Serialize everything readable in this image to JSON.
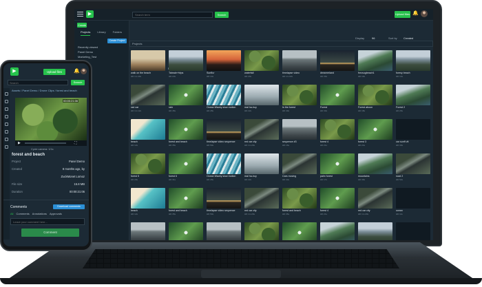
{
  "laptop": {
    "search": {
      "placeholder": "Search term",
      "button": "Search"
    },
    "top": {
      "upload": "Upload files",
      "new_label": "Create"
    },
    "sidebar": {
      "tabs": [
        {
          "label": "Projects"
        },
        {
          "label": "Library"
        },
        {
          "label": "Folders"
        }
      ],
      "create_btn": "Create Project",
      "items": [
        {
          "label": "Recently viewed"
        },
        {
          "label": "Panel Demo"
        },
        {
          "label": "Marketing_Test"
        }
      ]
    },
    "toolbar": {
      "display": "Display",
      "count": "96",
      "sort_label": "Sort by",
      "sort_value": "Created"
    },
    "filter": "Projects",
    "list_header": "Name",
    "tiles": [
      {
        "name": "walk on the beach",
        "meta": "HD 1m 40s",
        "thumb": "t-walk"
      },
      {
        "name": "Tatxsdn+trips",
        "meta": "HD 23s",
        "thumb": "t-mtn"
      },
      {
        "name": "Sunflur",
        "meta": "HD 14s",
        "thumb": "t-sunset"
      },
      {
        "name": "waterfall",
        "meta": "HD 20s",
        "thumb": "t-forest"
      },
      {
        "name": "timelapse video",
        "meta": "HD 1m 02s",
        "thumb": "t-city"
      },
      {
        "name": "dreamerland",
        "meta": "HD 30s",
        "thumb": "t-night"
      },
      {
        "name": "fnrcsugbeach1",
        "meta": "HD 19s",
        "thumb": "t-cliff"
      },
      {
        "name": "foresy beach",
        "meta": "HD 14s",
        "thumb": "t-mtn"
      },
      {
        "name": "rad car",
        "meta": "HD 1m 12s",
        "thumb": "t-road"
      },
      {
        "name": "rain",
        "meta": "HD 45s",
        "thumb": "t-palm"
      },
      {
        "name": "Ocean Wavey slow motion",
        "meta": "HD 28s",
        "thumb": "t-wave"
      },
      {
        "name": "mal ha-hoy",
        "meta": "HD 22s",
        "thumb": "t-fog"
      },
      {
        "name": "In the forest",
        "meta": "HD 40s",
        "thumb": "t-forest"
      },
      {
        "name": "Forest",
        "meta": "HD 33s",
        "thumb": "t-palm"
      },
      {
        "name": "Forest aboon",
        "meta": "HD 18s",
        "thumb": "t-forest"
      },
      {
        "name": "Forest 2",
        "meta": "HD 26s",
        "thumb": "t-cliff"
      },
      {
        "name": "beach",
        "meta": "HD 12s",
        "thumb": "t-beach"
      },
      {
        "name": "forest and beach",
        "meta": "HD 35s",
        "thumb": "t-palm"
      },
      {
        "name": "timelapse video sequence",
        "meta": "HD 50s",
        "thumb": "t-night"
      },
      {
        "name": "red car city",
        "meta": "HD 1m 20s",
        "thumb": "t-road"
      },
      {
        "name": "sequence #3",
        "meta": "HD 16s",
        "thumb": "t-city"
      },
      {
        "name": "forest 4",
        "meta": "HD 21s",
        "thumb": "t-forest"
      },
      {
        "name": "forest 3",
        "meta": "HD 24s",
        "thumb": "t-palm"
      },
      {
        "name": "car sunft vlt",
        "meta": "HD 30s",
        "thumb": "t-dark"
      },
      {
        "name": "forest 5",
        "meta": "HD 29s",
        "thumb": "t-forest"
      },
      {
        "name": "forest 6",
        "meta": "HD 31s",
        "thumb": "t-palm"
      },
      {
        "name": "Ocean Wavey slow motion",
        "meta": "HD 28s",
        "thumb": "t-wave"
      },
      {
        "name": "mal ha-hoy",
        "meta": "HD 22s",
        "thumb": "t-fog"
      },
      {
        "name": "Cars moving",
        "meta": "HD 44s",
        "thumb": "t-road"
      },
      {
        "name": "palm forest",
        "meta": "HD 17s",
        "thumb": "t-palm"
      },
      {
        "name": "mountains",
        "meta": "HD 39s",
        "thumb": "t-cliff"
      },
      {
        "name": "road 2",
        "meta": "HD 52s",
        "thumb": "t-road"
      },
      {
        "name": "beach",
        "meta": "HD 12s",
        "thumb": "t-beach"
      },
      {
        "name": "forest and beach",
        "meta": "HD 35s",
        "thumb": "t-palm"
      },
      {
        "name": "timelapse video sequence",
        "meta": "HD 50s",
        "thumb": "t-night"
      },
      {
        "name": "red car city",
        "meta": "HD 1m 20s",
        "thumb": "t-road"
      },
      {
        "name": "forest and beach",
        "meta": "HD 36s",
        "thumb": "t-forest"
      },
      {
        "name": "forest 4",
        "meta": "HD 21s",
        "thumb": "t-palm"
      },
      {
        "name": "red car city",
        "meta": "HD 1m 20s",
        "thumb": "t-road"
      },
      {
        "name": "ocean",
        "meta": "HD 11s",
        "thumb": "t-dark"
      },
      {
        "name": "city",
        "meta": "HD 18s",
        "thumb": "t-city"
      },
      {
        "name": "palms",
        "meta": "HD 20s",
        "thumb": "t-palm"
      },
      {
        "name": "city 2",
        "meta": "HD 25s",
        "thumb": "t-city"
      },
      {
        "name": "forest",
        "meta": "HD 27s",
        "thumb": "t-forest"
      },
      {
        "name": "forest",
        "meta": "HD 27s",
        "thumb": "t-palm"
      },
      {
        "name": "coast",
        "meta": "HD 33s",
        "thumb": "t-cliff"
      },
      {
        "name": "cliff",
        "meta": "HD 41s",
        "thumb": "t-mtn"
      },
      {
        "name": "night",
        "meta": "HD 15s",
        "thumb": "t-dark"
      }
    ]
  },
  "phone": {
    "upload": "Upload files",
    "search_placeholder": "Search",
    "search_btn": "Search",
    "breadcrumb": "Assets / Panel Demo / Drone Clips / forest and beach",
    "timecode": "00:00:21:06",
    "cycle_label": "Cycle camera: 1/1s",
    "title": "forest and beach",
    "props": [
      {
        "label": "Project",
        "value": "Panel Demo"
      },
      {
        "label": "Created",
        "value": "8 months ago, by"
      },
      {
        "label": "",
        "value": "ZuckMonet Lomoz"
      },
      {
        "label": "File size",
        "value": "15.8 MB"
      },
      {
        "label": "Duration",
        "value": "00:00:21:06"
      }
    ],
    "comments": {
      "title": "Comments",
      "download_btn": "Download comments",
      "tabs": [
        {
          "label": "All"
        },
        {
          "label": "Comments"
        },
        {
          "label": "Annotations"
        },
        {
          "label": "Approvals"
        }
      ],
      "placeholder": "Leave your comment here...",
      "submit": "Comment"
    }
  }
}
